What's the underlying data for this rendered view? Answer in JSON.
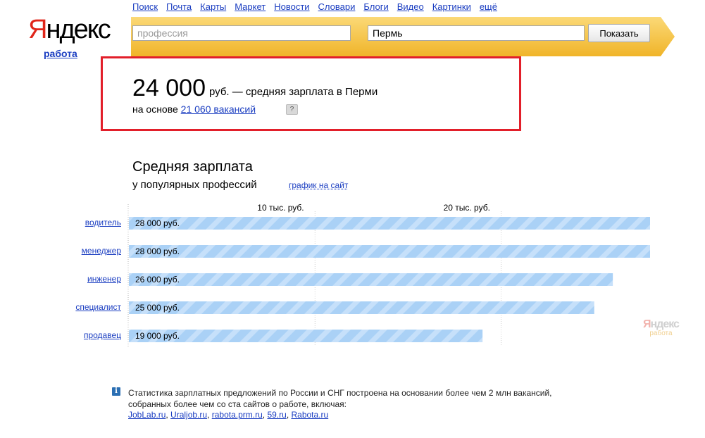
{
  "nav": {
    "items": [
      "Поиск",
      "Почта",
      "Карты",
      "Маркет",
      "Новости",
      "Словари",
      "Блоги",
      "Видео",
      "Картинки",
      "ещё"
    ]
  },
  "logo": {
    "word_first": "Я",
    "word_rest": "ндекс",
    "sub": "работа"
  },
  "search": {
    "profession_placeholder": "профессия",
    "profession_value": "",
    "city_value": "Пермь",
    "submit_label": "Показать"
  },
  "colors": {
    "accent_yellow": "#f7c245",
    "highlight_red": "#e21f2a",
    "bar_blue": "#aad1f6",
    "link_blue": "#1a3dc1"
  },
  "summary": {
    "amount": "24 000",
    "amount_tail": "руб. — средняя зарплата в Перми",
    "basis_prefix": "на основе ",
    "basis_link": "21 060 вакансий",
    "help_icon": "question-icon",
    "help_glyph": "?"
  },
  "chart_section": {
    "title": "Средняя зарплата",
    "subtitle": "у популярных профессий",
    "embed_link": "график на сайт"
  },
  "chart_data": {
    "type": "bar",
    "orientation": "horizontal",
    "categories": [
      "водитель",
      "менеджер",
      "инженер",
      "специалист",
      "продавец"
    ],
    "values": [
      28000,
      28000,
      26000,
      25000,
      19000
    ],
    "value_labels": [
      "28 000 руб.",
      "28 000 руб.",
      "26 000 руб.",
      "25 000 руб.",
      "19 000 руб."
    ],
    "ticks": [
      10000,
      20000
    ],
    "tick_labels": [
      "10 тыс. руб.",
      "20 тыс. руб."
    ],
    "xlim": [
      0,
      28000
    ],
    "grid": true
  },
  "watermark": {
    "word_first": "Я",
    "word_rest": "ндекс",
    "sub": "работа"
  },
  "footer": {
    "info_glyph": "i",
    "text_line1": "Статистика зарплатных предложений по России и СНГ построена на основании более чем 2 млн вакансий,",
    "text_line2": "собранных более чем со ста сайтов о работе, включая:",
    "links": [
      "JobLab.ru",
      "Uraljob.ru",
      "rabota.prm.ru",
      "59.ru",
      "Rabota.ru"
    ]
  }
}
